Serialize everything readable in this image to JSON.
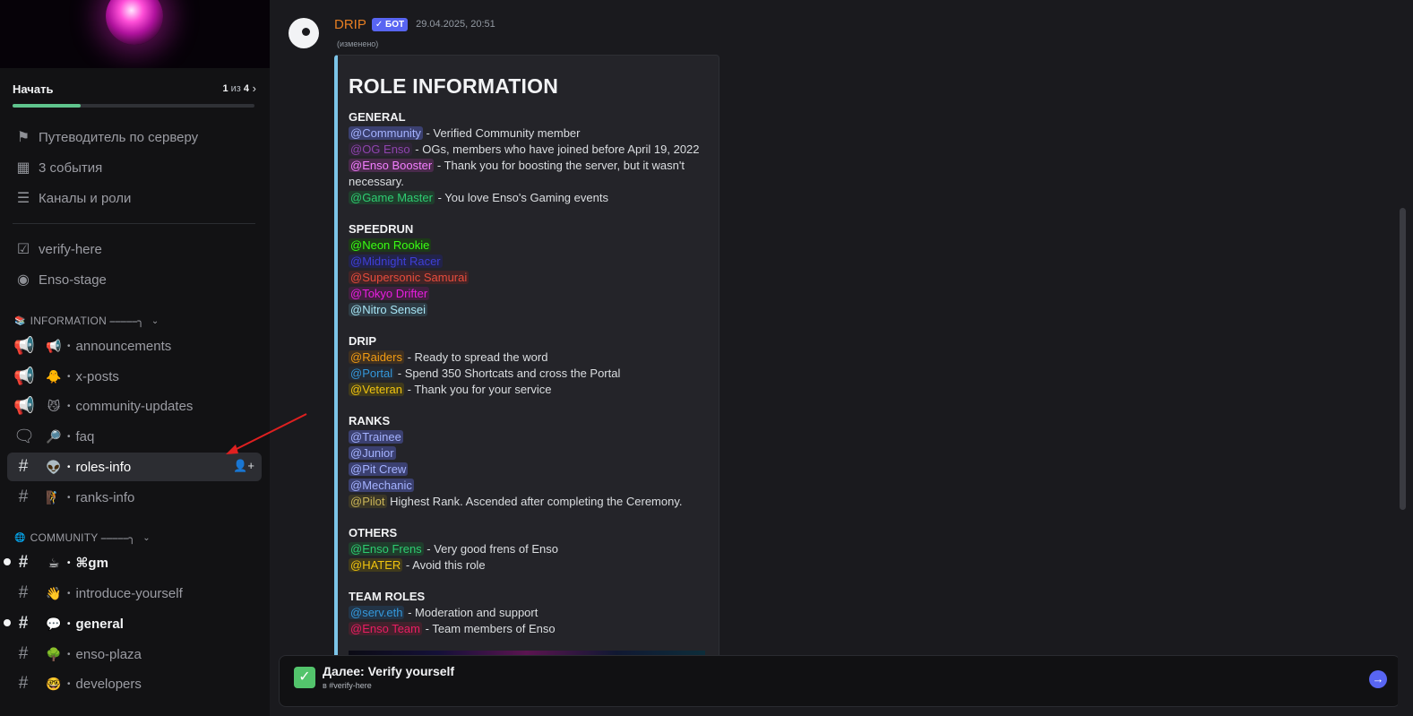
{
  "onboarding": {
    "title": "Начать",
    "step_current": "1",
    "step_sep": " из ",
    "step_total": "4",
    "progress": 0.28
  },
  "sidebar": {
    "top_items": [
      {
        "label": "Путеводитель по серверу",
        "icon": "signpost-icon"
      },
      {
        "label": "3 события",
        "icon": "calendar-icon"
      },
      {
        "label": "Каналы и роли",
        "icon": "channels-list-icon"
      }
    ],
    "pinned_channels": [
      {
        "label": "verify-here",
        "icon": "checkbox-icon"
      },
      {
        "label": "Enso-stage",
        "icon": "stage-icon"
      }
    ],
    "categories": [
      {
        "label": "INFORMATION ⎯⎯⎯⎯⎯╮",
        "icon": "books-icon",
        "channels": [
          {
            "label": "announcements",
            "emoji": "📢",
            "type": "announcement"
          },
          {
            "label": "x-posts",
            "emoji": "🐥",
            "type": "announcement"
          },
          {
            "label": "community-updates",
            "emoji": "😼",
            "type": "announcement"
          },
          {
            "label": "faq",
            "emoji": "🔎",
            "type": "forum"
          },
          {
            "label": "roles-info",
            "emoji": "👽",
            "type": "text",
            "active": true
          },
          {
            "label": "ranks-info",
            "emoji": "🧗",
            "type": "text"
          }
        ]
      },
      {
        "label": "COMMUNITY ⎯⎯⎯⎯⎯╮",
        "icon": "globe-icon",
        "channels": [
          {
            "label": "⌘gm",
            "emoji": "☕",
            "type": "text",
            "unread": true
          },
          {
            "label": "introduce-yourself",
            "emoji": "👋",
            "type": "text"
          },
          {
            "label": "general",
            "emoji": "💬",
            "type": "text",
            "unread": true
          },
          {
            "label": "enso-plaza",
            "emoji": "🌳",
            "type": "text"
          },
          {
            "label": "developers",
            "emoji": "🤓",
            "type": "text"
          }
        ]
      }
    ]
  },
  "message": {
    "author": "DRIP",
    "bot_badge": "✓ БОТ",
    "timestamp": "29.04.2025, 20:51",
    "edited": "(изменено)",
    "embed": {
      "title": "ROLE INFORMATION",
      "sections": [
        {
          "heading": "GENERAL",
          "lines": [
            {
              "mention": "@Community",
              "color": "#a4b2ff",
              "bg": "#3b4070",
              "text": " - Verified Community member"
            },
            {
              "mention": "@OG Enso",
              "color": "#8e44ad",
              "bg": "#2e2436",
              "text": " - OGs, members who have joined before April 19, 2022"
            },
            {
              "mention": "@Enso Booster",
              "color": "#f47fff",
              "bg": "#4a2a4c",
              "text": " - Thank you for boosting the server, but it wasn't necessary."
            },
            {
              "mention": "@Game Master",
              "color": "#2ecc71",
              "bg": "#1f3d2c",
              "text": " - You love Enso's Gaming events"
            }
          ]
        },
        {
          "heading": "SPEEDRUN",
          "lines": [
            {
              "mention": "@Neon Rookie",
              "color": "#39ff14",
              "bg": "#1d3a18",
              "text": ""
            },
            {
              "mention": "@Midnight Racer",
              "color": "#3f3fd6",
              "bg": "#22234a",
              "text": ""
            },
            {
              "mention": "@Supersonic Samurai",
              "color": "#e74c3c",
              "bg": "#422426",
              "text": ""
            },
            {
              "mention": "@Tokyo Drifter",
              "color": "#e91ee0",
              "bg": "#41203f",
              "text": ""
            },
            {
              "mention": "@Nitro Sensei",
              "color": "#a8e6f5",
              "bg": "#2e3c45",
              "text": ""
            }
          ]
        },
        {
          "heading": "DRIP",
          "lines": [
            {
              "mention": "@Raiders",
              "color": "#f39c12",
              "bg": "#3f3020",
              "text": " - Ready to spread the word"
            },
            {
              "mention": "@Portal",
              "color": "#3498db",
              "bg": "#242a33",
              "text": " - Spend 350 Shortcats and cross the Portal"
            },
            {
              "mention": "@Veteran",
              "color": "#f1c40f",
              "bg": "#403a1c",
              "text": " - Thank you for your service"
            }
          ]
        },
        {
          "heading": "RANKS",
          "lines": [
            {
              "mention": "@Trainee",
              "color": "#a4b2ff",
              "bg": "#3b4070",
              "text": ""
            },
            {
              "mention": "@Junior",
              "color": "#a4b2ff",
              "bg": "#3b4070",
              "text": ""
            },
            {
              "mention": "@Pit Crew",
              "color": "#a4b2ff",
              "bg": "#3b4070",
              "text": ""
            },
            {
              "mention": "@Mechanic",
              "color": "#a4b2ff",
              "bg": "#3b4070",
              "text": ""
            },
            {
              "mention": "@Pilot",
              "color": "#c9b458",
              "bg": "#3a3626",
              "text": " Highest Rank. Ascended after completing the Ceremony."
            }
          ]
        },
        {
          "heading": "OTHERS",
          "lines": [
            {
              "mention": "@Enso Frens",
              "color": "#2ecc71",
              "bg": "#1f3d2c",
              "text": " - Very good frens of Enso"
            },
            {
              "mention": "@HATER",
              "color": "#f1c40f",
              "bg": "#403a1c",
              "text": " - Avoid this role"
            }
          ]
        },
        {
          "heading": "TEAM ROLES",
          "lines": [
            {
              "mention": "@serv.eth",
              "color": "#3498db",
              "bg": "#223447",
              "text": " - Moderation and support"
            },
            {
              "mention": "@Enso Team",
              "color": "#e91e63",
              "bg": "#42212c",
              "text": " - Team members of Enso"
            }
          ]
        }
      ]
    }
  },
  "next_step": {
    "title": "Далее: Verify yourself",
    "subtitle": "в #verify-here"
  }
}
